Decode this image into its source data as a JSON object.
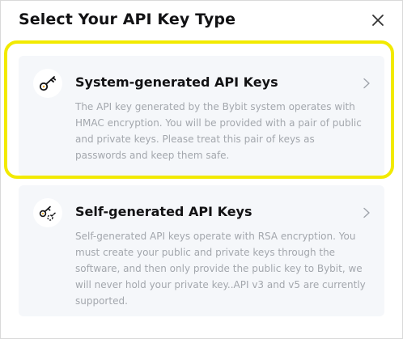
{
  "dialog": {
    "title": "Select Your API Key Type",
    "close_icon": "close-icon"
  },
  "cards": [
    {
      "icon": "key-icon",
      "title": "System-generated API Keys",
      "description": "The API key generated by the Bybit system operates with HMAC encryption. You will be provided with a pair of public and private keys. Please treat this pair of keys as passwords and keep them safe.",
      "highlighted": true
    },
    {
      "icon": "key-pair-icon",
      "title": "Self-generated API Keys",
      "description": "Self-generated API keys operate with RSA encryption. You must create your public and private keys through the software, and then only provide the public key to Bybit, we will never hold your private key..API v3 and v5 are currently supported.",
      "highlighted": false
    }
  ],
  "colors": {
    "highlight": "#f2ea00",
    "card_bg": "#f5f7fa",
    "title_text": "#121214",
    "desc_text": "#a3a7ad"
  }
}
